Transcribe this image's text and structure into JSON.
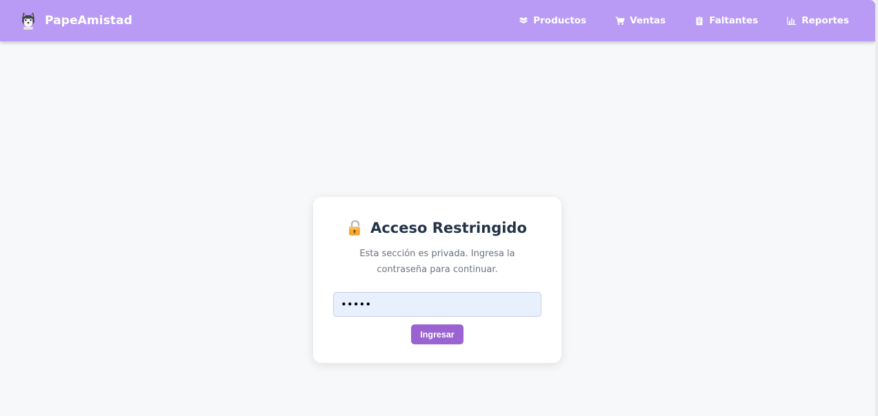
{
  "navbar": {
    "brand": {
      "name": "PapeAmistad",
      "logo_icon": "husky-dog-logo-icon"
    },
    "links": [
      {
        "label": "Productos",
        "icon": "box-icon"
      },
      {
        "label": "Ventas",
        "icon": "shopping-cart-icon"
      },
      {
        "label": "Faltantes",
        "icon": "clipboard-icon"
      },
      {
        "label": "Reportes",
        "icon": "bar-chart-icon"
      }
    ]
  },
  "login_card": {
    "title": "Acceso Restringido",
    "title_icon": "lock-icon",
    "description": "Esta sección es privada. Ingresa la contraseña para continuar.",
    "password_value": "•••••",
    "submit_label": "Ingresar"
  },
  "colors": {
    "navbar_background": "#b99bf5",
    "button_background": "#9b62d1",
    "page_background": "#f7f8fa",
    "title_text": "#233348",
    "input_background": "#e8f0fe"
  }
}
